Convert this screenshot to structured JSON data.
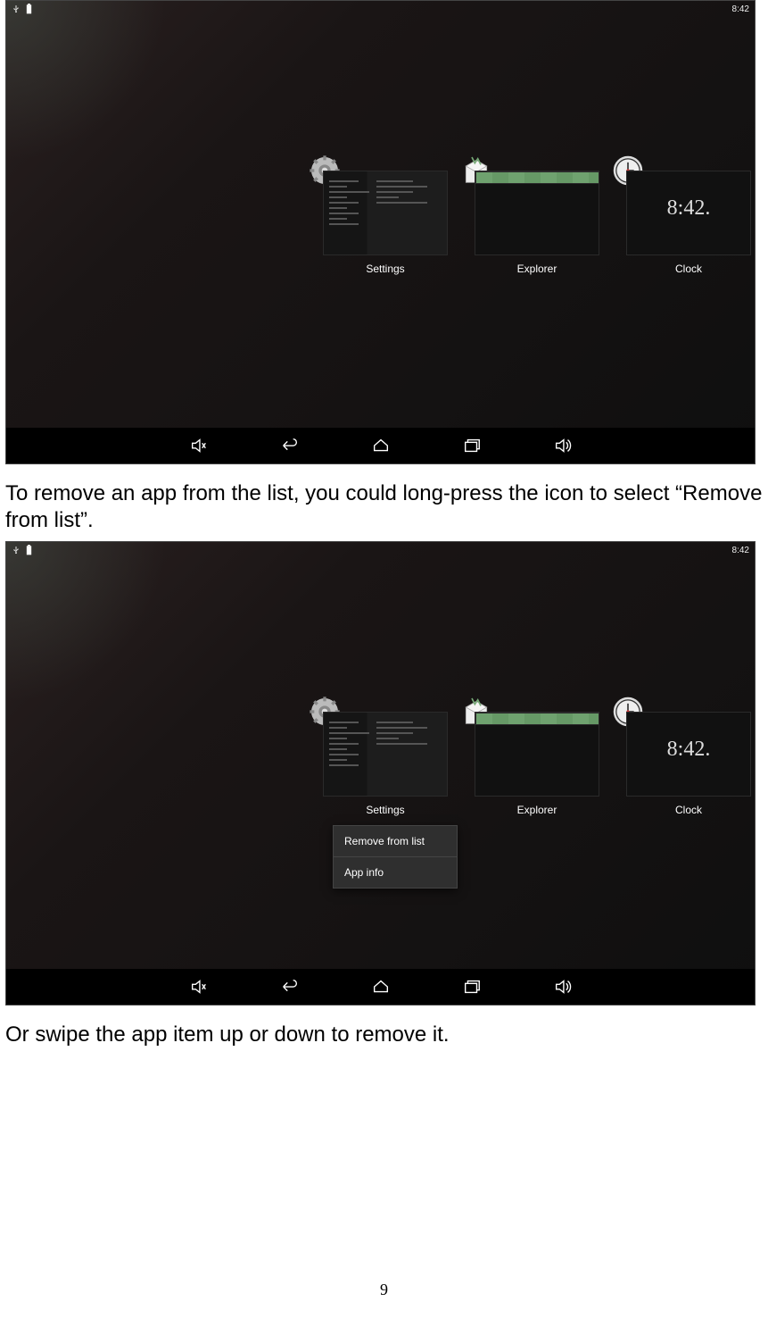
{
  "statusbar": {
    "time": "8:42"
  },
  "recents": {
    "settings_label": "Settings",
    "explorer_label": "Explorer",
    "clock_label": "Clock",
    "clock_display": "8:42."
  },
  "context_menu": {
    "remove": "Remove from list",
    "app_info": "App info"
  },
  "doc": {
    "text1": "To remove an app from the list, you could long-press the icon to select “Remove from list”.",
    "text2": "Or swipe the app item up or down to remove it.",
    "page_number": "9"
  }
}
